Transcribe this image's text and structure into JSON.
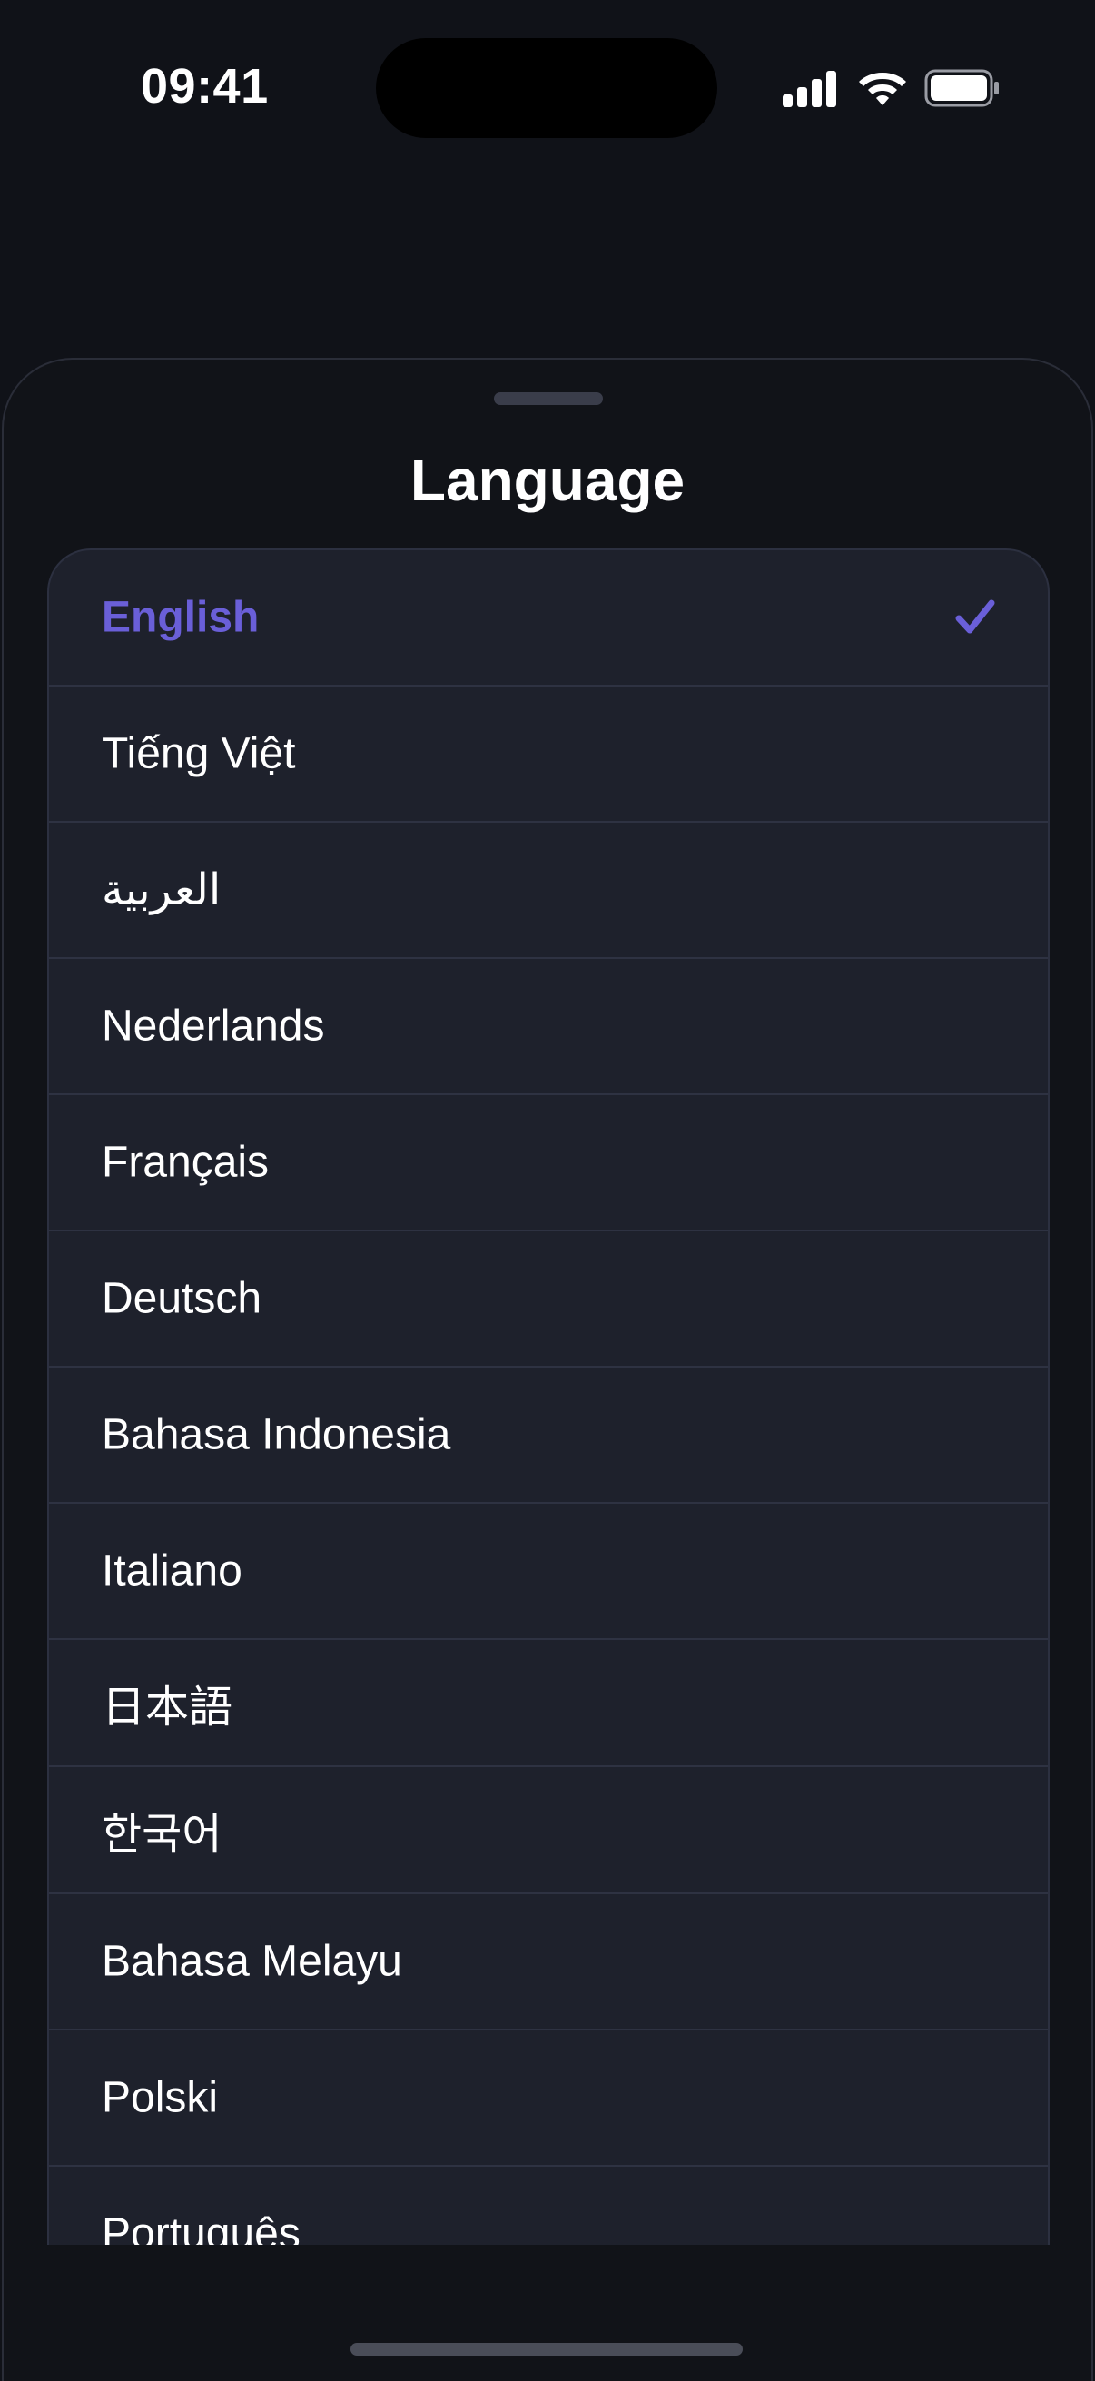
{
  "status_bar": {
    "time": "09:41"
  },
  "sheet": {
    "title": "Language",
    "selected_index": 0,
    "accent_color": "#6a5fd8",
    "items": [
      {
        "label": "English",
        "selected": true
      },
      {
        "label": "Tiếng Việt",
        "selected": false
      },
      {
        "label": "العربية",
        "selected": false
      },
      {
        "label": "Nederlands",
        "selected": false
      },
      {
        "label": "Français",
        "selected": false
      },
      {
        "label": "Deutsch",
        "selected": false
      },
      {
        "label": "Bahasa Indonesia",
        "selected": false
      },
      {
        "label": "Italiano",
        "selected": false
      },
      {
        "label": "日本語",
        "selected": false
      },
      {
        "label": "한국어",
        "selected": false
      },
      {
        "label": "Bahasa Melayu",
        "selected": false
      },
      {
        "label": "Polski",
        "selected": false
      },
      {
        "label": "Português",
        "selected": false
      }
    ]
  },
  "icons": {
    "signal": "cellular-signal-icon",
    "wifi": "wifi-icon",
    "battery": "battery-icon",
    "check": "checkmark-icon"
  }
}
